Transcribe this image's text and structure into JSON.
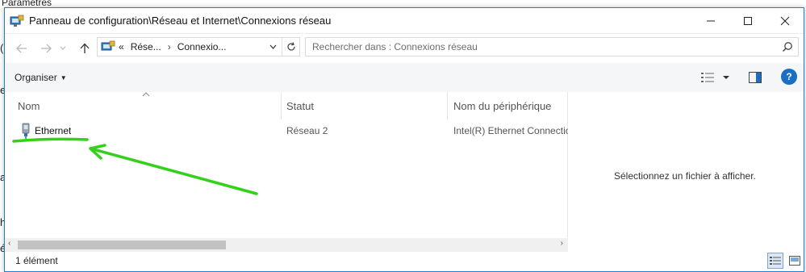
{
  "background": {
    "title_fragment": "Paramètres",
    "side_letters": [
      "(",
      "e",
      "a",
      "h",
      "é"
    ]
  },
  "window": {
    "title": "Panneau de configuration\\Réseau et Internet\\Connexions réseau",
    "controls": {
      "minimize_icon": "minimize-icon",
      "maximize_icon": "maximize-icon",
      "close_icon": "close-icon"
    }
  },
  "nav": {
    "back_icon": "back-arrow-icon",
    "forward_icon": "forward-arrow-icon",
    "recent_icon": "chevron-down-icon",
    "up_icon": "up-arrow-icon",
    "address": {
      "overflow": "«",
      "crumbs": [
        "Rése...",
        "Connexio..."
      ],
      "separator": "›"
    },
    "search_placeholder": "Rechercher dans : Connexions réseau"
  },
  "commandbar": {
    "organise_label": "Organiser",
    "help_label": "?"
  },
  "list": {
    "columns": [
      "Nom",
      "Statut",
      "Nom du périphérique"
    ],
    "rows": [
      {
        "name": "Ethernet",
        "status": "Réseau 2",
        "device": "Intel(R) Ethernet Connection"
      }
    ]
  },
  "preview": {
    "message": "Sélectionnez un fichier à afficher."
  },
  "status": {
    "count": "1 élément"
  },
  "colors": {
    "accent": "#1f7fd6",
    "annotation": "#33d11a",
    "help": "#1a6fc4"
  }
}
